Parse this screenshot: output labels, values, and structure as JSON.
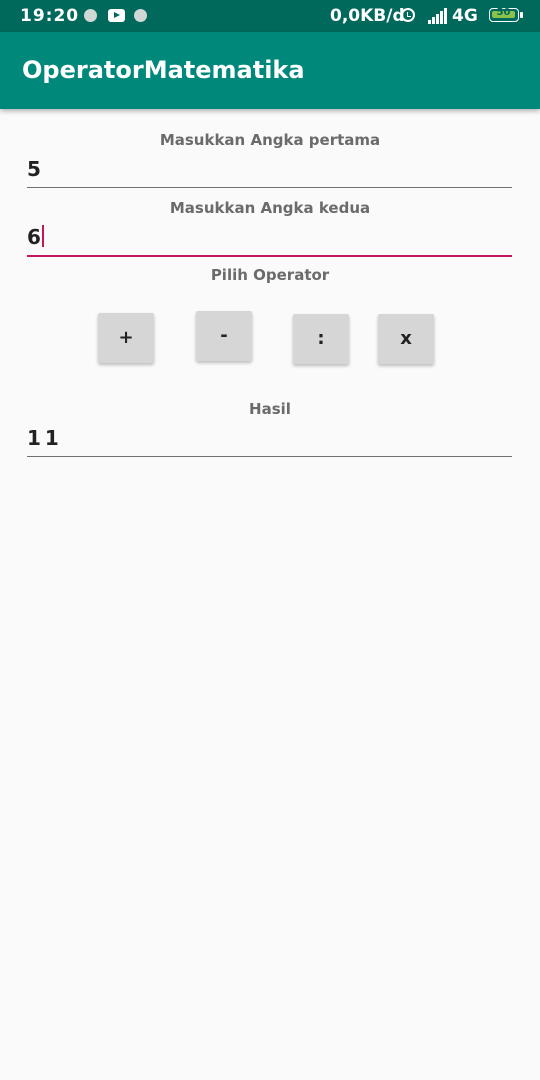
{
  "status_bar": {
    "time": "19:20",
    "speed": "0,0KB/d",
    "network": "4G",
    "battery": "50",
    "icons": [
      "notification-dot-icon",
      "youtube-icon",
      "notification-dot-icon",
      "alarm-icon",
      "signal-icon",
      "battery-icon"
    ]
  },
  "app_bar": {
    "title": "OperatorMatematika"
  },
  "form": {
    "first_label": "Masukkan Angka pertama",
    "first_value": "5",
    "second_label": "Masukkan Angka kedua",
    "second_value": "6",
    "operator_label": "Pilih Operator",
    "operators": [
      "+",
      "-",
      ":",
      "x"
    ],
    "result_label": "Hasil",
    "result_value": "11"
  },
  "colors": {
    "status_bar": "#00695c",
    "app_bar": "#00897b",
    "accent": "#c2185b",
    "background": "#fafafa"
  }
}
